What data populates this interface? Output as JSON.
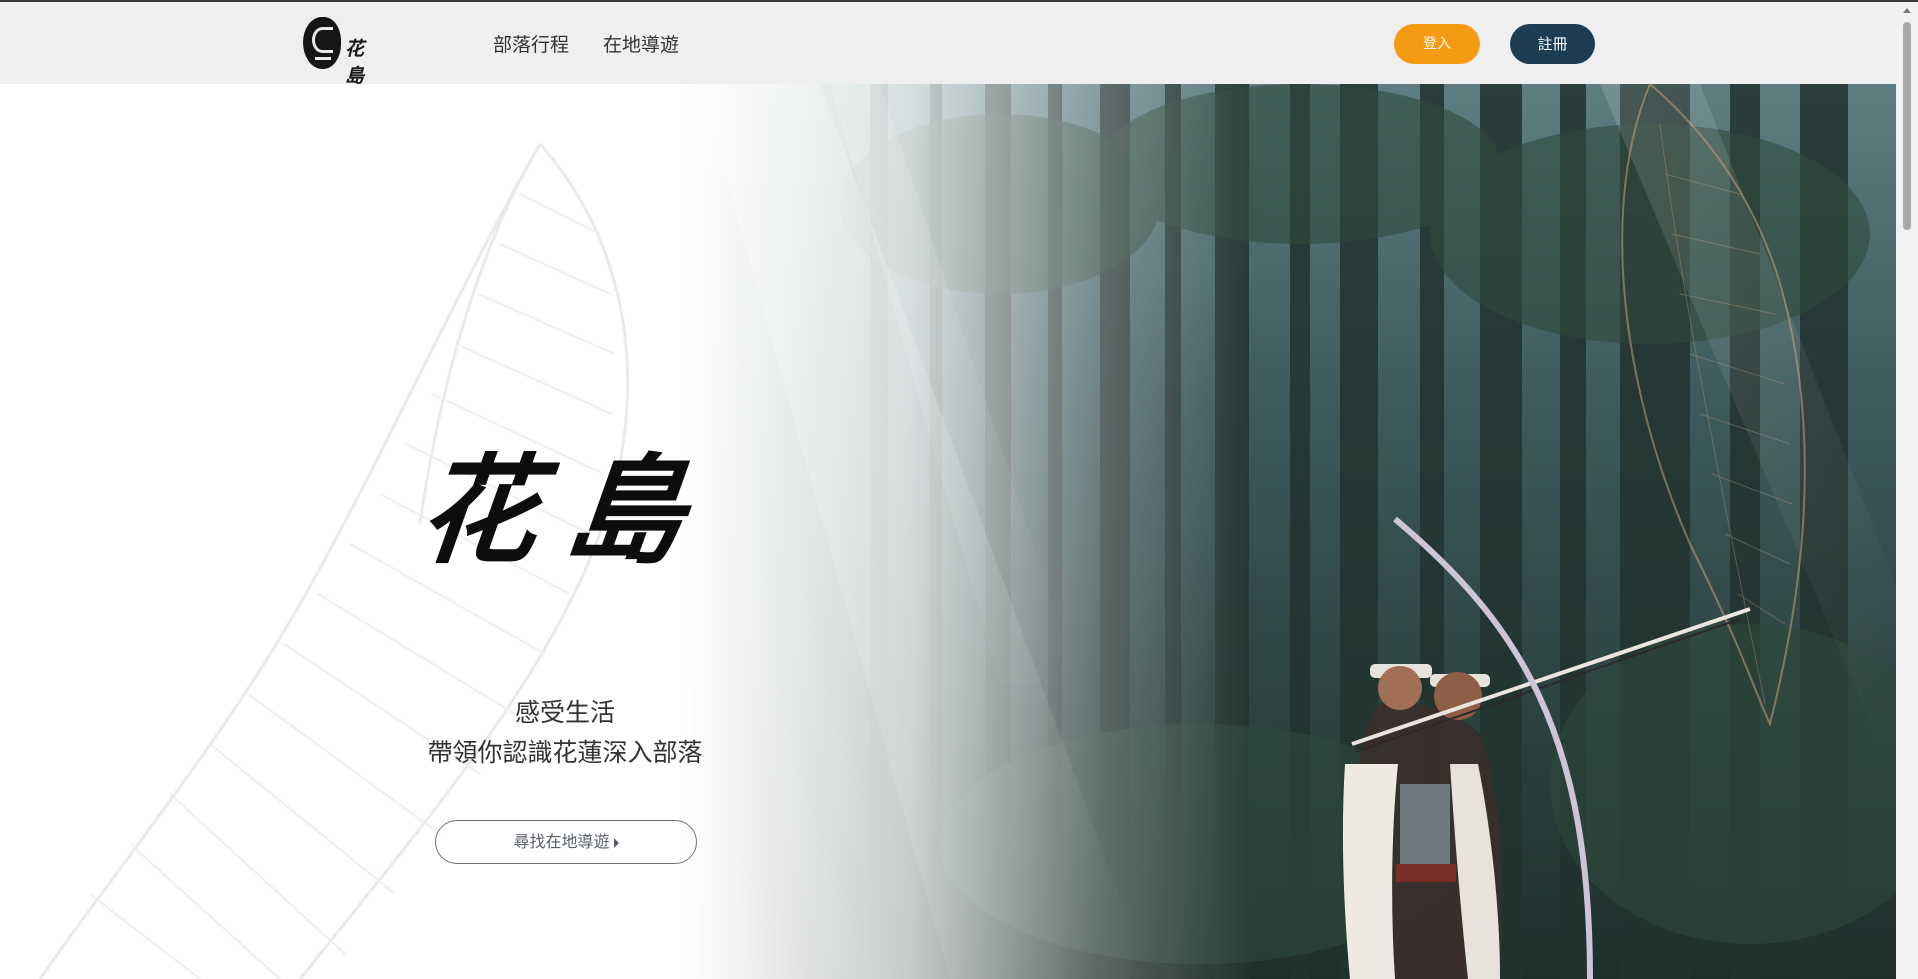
{
  "header": {
    "logo_text": "花島",
    "nav": [
      "部落行程",
      "在地導遊"
    ],
    "login_label": "登入",
    "register_label": "註冊"
  },
  "hero": {
    "title": "花島",
    "tagline_line1": "感受生活",
    "tagline_line2": "帶領你認識花蓮深入部落",
    "cta_label": "尋找在地導遊"
  },
  "colors": {
    "header_bg": "#efefef",
    "login_button": "#f59a13",
    "register_button": "#1c3d54"
  },
  "icons": {
    "logo": "hualien-island-logo",
    "cta_arrow": "caret-right-icon",
    "scroll": "scrollbar-thumb"
  }
}
